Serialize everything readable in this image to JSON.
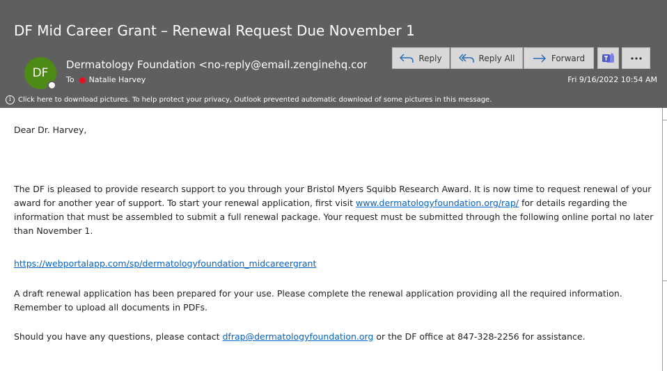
{
  "header": {
    "subject": "DF Mid Career Grant – Renewal Request Due November 1",
    "avatar_initials": "DF",
    "sender": "Dermatology Foundation <no-reply@email.zenginehq.com>",
    "to_label": "To",
    "recipient": "Natalie Harvey",
    "date": "Fri 9/16/2022 10:54 AM",
    "info_message": "Click here to download pictures. To help protect your privacy, Outlook prevented automatic download of some pictures in this message.",
    "buttons": {
      "reply": "Reply",
      "reply_all": "Reply All",
      "forward": "Forward"
    }
  },
  "body": {
    "greeting": "Dear Dr. Harvey,",
    "para1_text_a": "The DF is pleased to provide research support to you through your Bristol Myers Squibb Research Award.  It is now time to request renewal of your award for another year of support. To start your renewal application, first visit ",
    "para1_link": "www.dermatologyfoundation.org/rap/",
    "para1_text_b": " for details regarding the information that must be assembled to submit a full renewal package. Your request must be submitted through the following online portal no later than November 1.",
    "portal_link": "https://webportalapp.com/sp/dermatologyfoundation_midcareergrant",
    "para2": "A draft renewal application has been prepared for your use. Please complete the renewal application providing all the required information. Remember to upload all documents in PDFs.",
    "para3_text_a": "Should you have any questions, please contact ",
    "para3_link": "dfrap@dermatologyfoundation.org",
    "para3_text_b": " or the DF office at 847-328-2256 for assistance."
  },
  "colors": {
    "header_bg": "#5f5f5f",
    "avatar_bg": "#4d8a16",
    "presence_busy": "#e81123",
    "link": "#0563c1",
    "arrow_blue": "#2b6cb0",
    "teams_purple": "#5059c9"
  },
  "icons": {
    "reply": "reply-arrow-icon",
    "reply_all": "reply-all-arrow-icon",
    "forward": "forward-arrow-icon",
    "teams": "teams-icon",
    "more": "more-ellipsis-icon",
    "info": "info-icon",
    "presence": "presence-busy-icon"
  }
}
